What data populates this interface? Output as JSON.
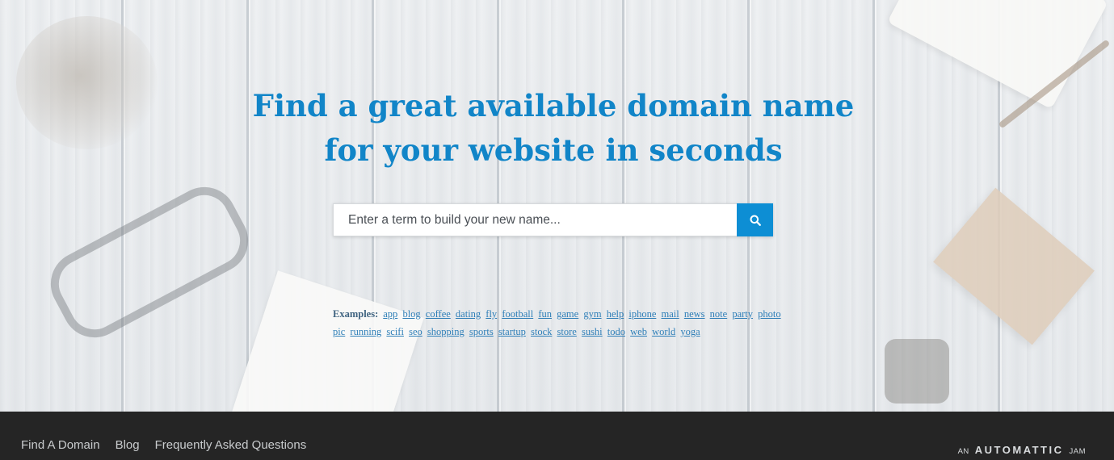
{
  "hero": {
    "headline_line1": "Find a great available domain name",
    "headline_line2": "for your website in seconds"
  },
  "search": {
    "placeholder": "Enter a term to build your new name...",
    "value": "",
    "button_icon": "search-icon"
  },
  "examples": {
    "label": "Examples:",
    "items": [
      "app",
      "blog",
      "coffee",
      "dating",
      "fly",
      "football",
      "fun",
      "game",
      "gym",
      "help",
      "iphone",
      "mail",
      "news",
      "note",
      "party",
      "photo",
      "pic",
      "running",
      "scifi",
      "seo",
      "shopping",
      "sports",
      "startup",
      "stock",
      "store",
      "sushi",
      "todo",
      "web",
      "world",
      "yoga"
    ]
  },
  "footer": {
    "nav": [
      "Find A Domain",
      "Blog",
      "Frequently Asked Questions"
    ],
    "brand": {
      "prefix": "AN",
      "name": "AUTOMATTIC",
      "suffix": "JAM"
    }
  },
  "colors": {
    "accent": "#1185c8",
    "search_button": "#0d8ed4",
    "footer_bg": "#252525",
    "link": "#2f7fb8"
  }
}
